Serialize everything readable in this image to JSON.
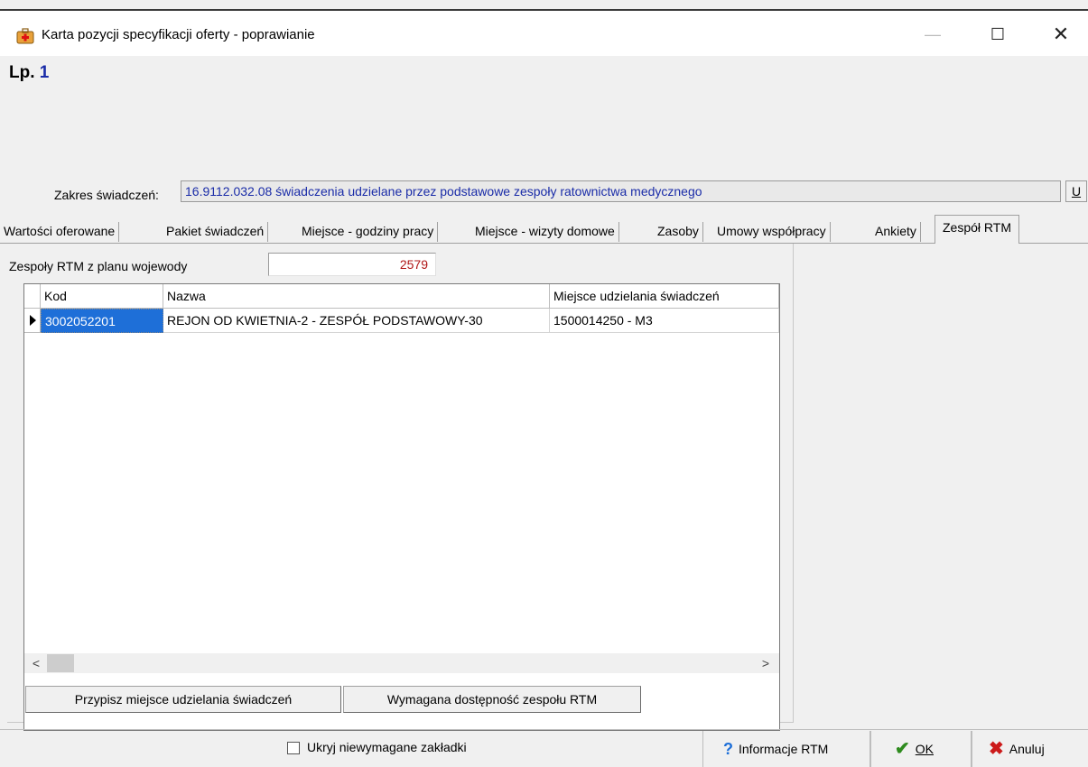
{
  "window": {
    "title": "Karta pozycji specyfikacji oferty - poprawianie",
    "minimize": "—",
    "maximize": "☐",
    "close": "✕"
  },
  "header": {
    "lp_label": "Lp.",
    "lp_value": "1"
  },
  "zakres": {
    "label": "Zakres świadczeń:",
    "value": "16.9112.032.08 świadczenia udzielane przez podstawowe zespoły ratownictwa medycznego",
    "u_button": "U"
  },
  "tabs": [
    {
      "label": "Wartości oferowane"
    },
    {
      "label": "Pakiet świadczeń"
    },
    {
      "label": "Miejsce - godziny pracy"
    },
    {
      "label": "Miejsce - wizyty domowe"
    },
    {
      "label": "Zasoby"
    },
    {
      "label": "Umowy współpracy"
    },
    {
      "label": "Ankiety"
    },
    {
      "label": "Zespół RTM",
      "active": true
    }
  ],
  "rtm": {
    "label": "Zespoły RTM z planu wojewody",
    "value": "2579"
  },
  "grid": {
    "columns": [
      "Kod",
      "Nazwa",
      "Miejsce udzielania świadczeń"
    ],
    "rows": [
      {
        "kod": "3002052201",
        "nazwa": "REJON OD KWIETNIA-2 - ZESPÓŁ PODSTAWOWY-30",
        "miejsce": "1500014250 - M3"
      }
    ]
  },
  "buttons": {
    "przypisz": "Przypisz miejsce udzielania świadczeń",
    "wymagana": "Wymagana dostępność zespołu RTM"
  },
  "footer": {
    "checkbox_label": "Ukryj niewymagane zakładki",
    "checkbox_checked": false,
    "info_button": "Informacje RTM",
    "ok_button": "OK",
    "cancel_button": "Anuluj"
  },
  "colors": {
    "accent_blue": "#1a2ca8",
    "selection": "#1e6fd8",
    "value_red": "#b01818"
  }
}
